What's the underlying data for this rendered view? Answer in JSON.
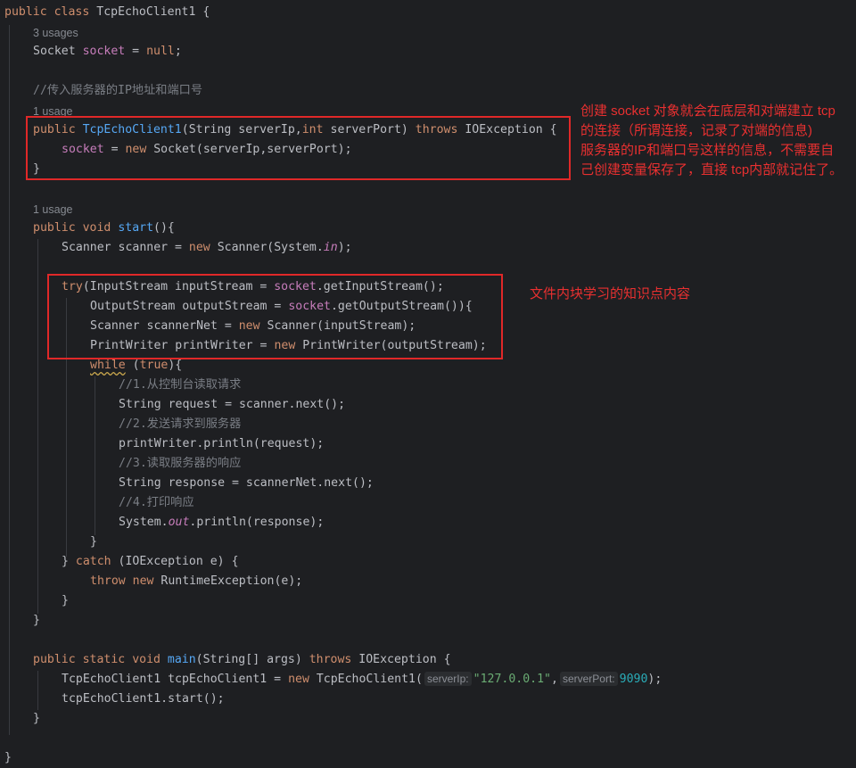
{
  "code": {
    "class_decl": {
      "kw1": "public",
      "kw2": "class",
      "name": "TcpEchoClient1",
      "brace": " {"
    },
    "usage_3": "3 usages",
    "field": {
      "type": "Socket",
      "name": "socket",
      "eq": " = ",
      "value": "null",
      "end": ";"
    },
    "comment_ctor": "//传入服务器的IP地址和端口号",
    "usage_1a": "1 usage",
    "ctor": {
      "kw": "public",
      "name": "TcpEchoClient1",
      "open": "(String serverIp,",
      "int_kw": "int",
      "params": " serverPort) ",
      "throws": "throws",
      "rest": " IOException {"
    },
    "ctor_body": {
      "field": "socket",
      "eq": " = ",
      "new_kw": "new",
      "rest": " Socket(serverIp,serverPort);"
    },
    "close": "}",
    "usage_1b": "1 usage",
    "start_decl": {
      "kw1": "public",
      "kw2": "void",
      "name": "start",
      "rest": "(){"
    },
    "scanner_line": {
      "a": "Scanner scanner = ",
      "new_kw": "new",
      "b": " Scanner(System.",
      "in_field": "in",
      "c": ");"
    },
    "try_line": {
      "kw": "try",
      "a": "(InputStream inputStream = ",
      "field": "socket",
      "b": ".getInputStream();"
    },
    "output_line": {
      "a": "OutputStream outputStream = ",
      "field": "socket",
      "b": ".getOutputStream()){"
    },
    "scannernet_line": {
      "a": "Scanner scannerNet = ",
      "new_kw": "new",
      "b": " Scanner(inputStream);"
    },
    "printwriter_line": {
      "a": "PrintWriter printWriter = ",
      "new_kw": "new",
      "b": " PrintWriter(outputStream);"
    },
    "while_line": {
      "kw": "while",
      "a": " (",
      "true_kw": "true",
      "b": "){"
    },
    "c1": "//1.从控制台读取请求",
    "request_line": "String request = scanner.next();",
    "c2": "//2.发送请求到服务器",
    "println_line": "printWriter.println(request);",
    "c3": "//3.读取服务器的响应",
    "response_line": "String response = scannerNet.next();",
    "c4": "//4.打印响应",
    "sysout_line": {
      "a": "System.",
      "out_field": "out",
      "b": ".println(response);"
    },
    "catch_line": {
      "a": "} ",
      "kw": "catch",
      "b": " (IOException e) {"
    },
    "throw_line": {
      "kw1": "throw",
      "kw2": "new",
      "rest": " RuntimeException(e);"
    },
    "main_decl": {
      "kw1": "public",
      "kw2": "static",
      "kw3": "void",
      "name": "main",
      "a": "(String[] args) ",
      "throws": "throws",
      "rest": " IOException {"
    },
    "main_body": {
      "a": "TcpEchoClient1 tcpEchoClient1 = ",
      "new_kw": "new",
      "b": " TcpEchoClient1(",
      "hint1": "serverIp:",
      "str": "\"127.0.0.1\"",
      "comma": ",",
      "hint2": "serverPort:",
      "num": "9090",
      "end": ");"
    },
    "start_call": "tcpEchoClient1.start();"
  },
  "annotations": {
    "note1_lines": [
      "创建 socket 对象就会在底层和对端建立 tcp",
      "的连接（所谓连接，记录了对端的信息)",
      "服务器的IP和端口号这样的信息，不需要自",
      "己创建变量保存了，直接 tcp内部就记住了。"
    ],
    "note2": "文件内块学习的知识点内容"
  },
  "colors": {
    "background": "#1e1f22",
    "keyword": "#cf8e6d",
    "function": "#56a8f5",
    "field": "#c77dbb",
    "comment": "#7a7e85",
    "string": "#6aab73",
    "number": "#2aacb8",
    "annotation": "#e02828"
  }
}
